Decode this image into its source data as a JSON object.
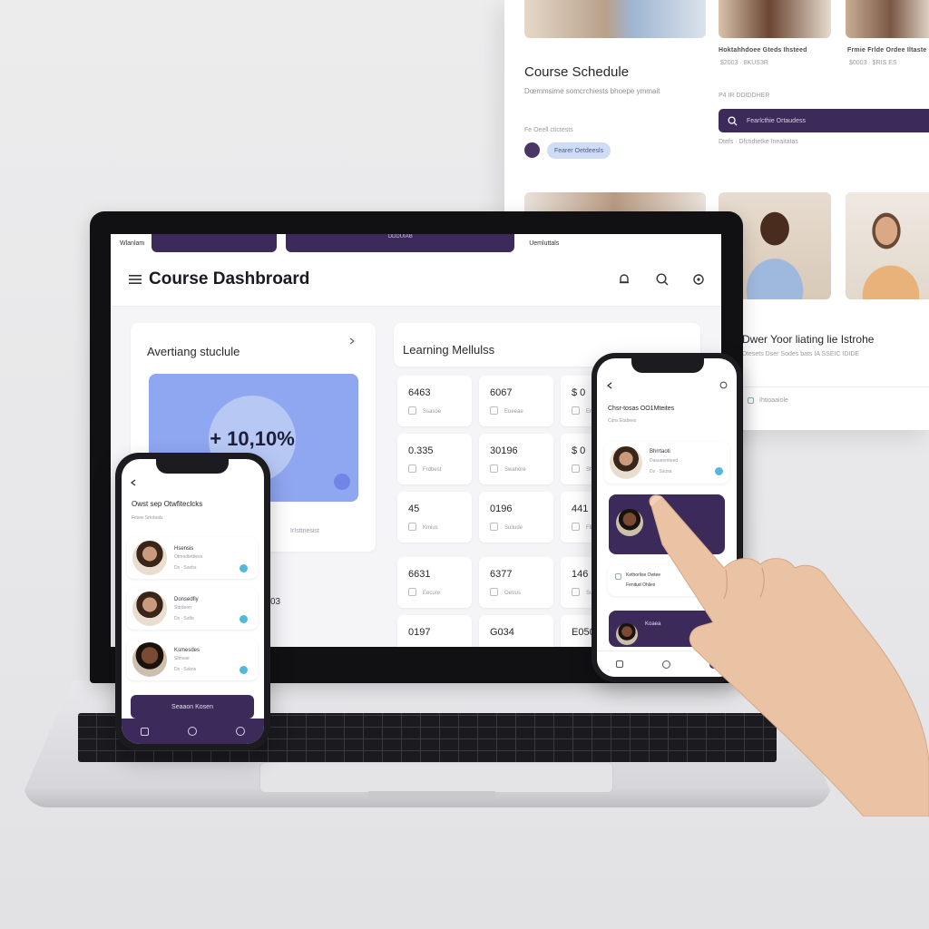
{
  "background_page": {
    "title": "Course Schedule",
    "subtitle": "Dœmmsime somcrchiests bhoepe ymmait",
    "filter_label": "Fe Oeell ctictests",
    "pill_label": "Fearer Oetdeesls",
    "photo_captions": [
      "Hoktahhdoee Gteds Ihsteed",
      "Frmie Frlde Ordee Iltaste"
    ],
    "photo_meta": [
      "$2003 · 8KUS3R",
      "$0003 · $RIS ES"
    ],
    "section_heading": "P4 IR DDIDDHER",
    "search_text": "Fearlcthie Ortaudess",
    "search_meta": "Dtefs · Dfctidtetke Ineaitatas",
    "bottom_heading": "Dwer Yoor liating lie Istrohe",
    "bottom_meta": "Dtesets Dser Sodes bats IA SSEIC IDIDE",
    "footer_label": "Ihtioaaiole"
  },
  "laptop": {
    "topbar_text": [
      "Wlanlam",
      "DDDUIAB",
      "Uemluttals"
    ],
    "header": {
      "title": "Course Dashbroard"
    },
    "left_card": {
      "title": "Avertiang stuclule",
      "progress_value": "+ 10,10%",
      "caption": "IrIsttnesist"
    },
    "right_card": {
      "title": "Learning Mellulss",
      "modules": [
        {
          "value": "6463",
          "label": "Ssasoe"
        },
        {
          "value": "6067",
          "label": "Eueeae"
        },
        {
          "value": "$ 0",
          "label": "Eraam"
        },
        {
          "value": "0.335",
          "label": "Frdbest"
        },
        {
          "value": "30196",
          "label": "Swahore"
        },
        {
          "value": "$ 0",
          "label": "Shnou"
        },
        {
          "value": "45",
          "label": "Kmius"
        },
        {
          "value": "0196",
          "label": "Suliude"
        },
        {
          "value": "441",
          "label": "Flirs"
        },
        {
          "value": "6631",
          "label": "Eecure"
        },
        {
          "value": "6377",
          "label": "Oetrus"
        },
        {
          "value": "146",
          "label": "Suicts"
        },
        {
          "value": "0197",
          "label": ""
        },
        {
          "value": "G034",
          "label": ""
        },
        {
          "value": "E050",
          "label": ""
        }
      ],
      "side_value": "03"
    }
  },
  "left_phone": {
    "title": "Owst sep Otwfiteclcks",
    "subtitle": "Feiew Srtotaals",
    "items": [
      {
        "name": "Hsensis",
        "sub": "Otmndtetbess",
        "meta": "Ds · Ssebs"
      },
      {
        "name": "Donsedfiy",
        "sub": "Sttrdeen",
        "meta": "Ds · Sstfe"
      },
      {
        "name": "Ksmesdes",
        "sub": "Sltnsae",
        "meta": "Ds · Sskns"
      }
    ],
    "button_label": "Seaaon Kosen"
  },
  "right_phone": {
    "title": "Chsr-tosas OO1Mteites",
    "subtitle": "Cdns Etabees",
    "items": [
      {
        "name": "Bhrrtaoti",
        "sub": "Dasueemteed",
        "meta": "Ds · Ssusa"
      },
      {
        "name": "Kethorlise Owtee",
        "sub": "Fenitud Ohlies",
        "meta": ""
      },
      {
        "name": "Koaea",
        "sub": "",
        "meta": ""
      }
    ]
  },
  "colors": {
    "accent_dark": "#3b2a5a",
    "progress_blue": "#8fa6f0",
    "pill_blue": "#cfdcf6",
    "badge_teal": "#56b8d8"
  },
  "icons": [
    "menu-icon",
    "bell-icon",
    "search-icon",
    "settings-icon",
    "chevron-right-icon",
    "back-icon",
    "home-icon",
    "profile-icon"
  ]
}
